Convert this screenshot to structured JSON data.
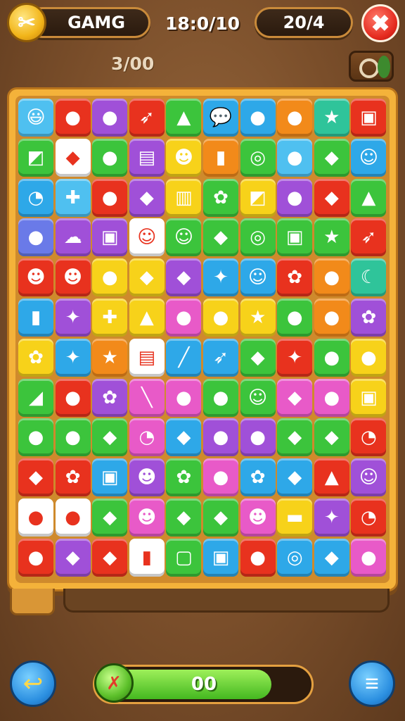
{
  "header": {
    "gem_label": "GAMG",
    "timer": "18:0/10",
    "score": "20/4",
    "moves": "3/00"
  },
  "icons": {
    "coin": "✂",
    "close": "✖",
    "back": "↩",
    "progress": "✗",
    "menu": "≡"
  },
  "progress": {
    "label": "00",
    "fraction": 0.82
  },
  "board": {
    "columns": 10,
    "rows": 12,
    "tiles": [
      [
        "#4fc0f0",
        "😃"
      ],
      [
        "#e8321e",
        "●"
      ],
      [
        "#a050d8",
        "●"
      ],
      [
        "#e8321e",
        "➶"
      ],
      [
        "#3cc43c",
        "▲"
      ],
      [
        "#2ea8e8",
        "💬"
      ],
      [
        "#2ea8e8",
        "●"
      ],
      [
        "#f28a1a",
        "●"
      ],
      [
        "#2fc49a",
        "★"
      ],
      [
        "#e8321e",
        "▣"
      ],
      [
        "#3cc43c",
        "◩"
      ],
      [
        "#ffffff",
        "◆"
      ],
      [
        "#3cc43c",
        "●"
      ],
      [
        "#a050d8",
        "▤"
      ],
      [
        "#f7d21a",
        "☻"
      ],
      [
        "#f28a1a",
        "▮"
      ],
      [
        "#3cc43c",
        "◎"
      ],
      [
        "#4fc0f0",
        "●"
      ],
      [
        "#3cc43c",
        "◆"
      ],
      [
        "#2ea8e8",
        "☺"
      ],
      [
        "#2ea8e8",
        "◔"
      ],
      [
        "#4fc0f0",
        "✚"
      ],
      [
        "#e8321e",
        "●"
      ],
      [
        "#a050d8",
        "◆"
      ],
      [
        "#f7d21a",
        "▥"
      ],
      [
        "#3cc43c",
        "✿"
      ],
      [
        "#f7d21a",
        "◩"
      ],
      [
        "#a050d8",
        "●"
      ],
      [
        "#e8321e",
        "◆"
      ],
      [
        "#3cc43c",
        "▲"
      ],
      [
        "#6a7ae8",
        "●"
      ],
      [
        "#a050d8",
        "☁"
      ],
      [
        "#a050d8",
        "▣"
      ],
      [
        "#ffffff",
        "☺"
      ],
      [
        "#3cc43c",
        "☺"
      ],
      [
        "#3cc43c",
        "◆"
      ],
      [
        "#3cc43c",
        "◎"
      ],
      [
        "#3cc43c",
        "▣"
      ],
      [
        "#3cc43c",
        "★"
      ],
      [
        "#e8321e",
        "➶"
      ],
      [
        "#e8321e",
        "☻"
      ],
      [
        "#e8321e",
        "☻"
      ],
      [
        "#f7d21a",
        "●"
      ],
      [
        "#f7d21a",
        "◆"
      ],
      [
        "#a050d8",
        "◆"
      ],
      [
        "#2ea8e8",
        "✦"
      ],
      [
        "#2ea8e8",
        "☺"
      ],
      [
        "#e8321e",
        "✿"
      ],
      [
        "#f28a1a",
        "●"
      ],
      [
        "#2fc49a",
        "☾"
      ],
      [
        "#2ea8e8",
        "▮"
      ],
      [
        "#a050d8",
        "✦"
      ],
      [
        "#f7d21a",
        "✚"
      ],
      [
        "#f7d21a",
        "▲"
      ],
      [
        "#e85ac8",
        "●"
      ],
      [
        "#f7d21a",
        "●"
      ],
      [
        "#f7d21a",
        "★"
      ],
      [
        "#3cc43c",
        "●"
      ],
      [
        "#f28a1a",
        "●"
      ],
      [
        "#a050d8",
        "✿"
      ],
      [
        "#f7d21a",
        "✿"
      ],
      [
        "#2ea8e8",
        "✦"
      ],
      [
        "#f28a1a",
        "★"
      ],
      [
        "#ffffff",
        "▤"
      ],
      [
        "#2ea8e8",
        "╱"
      ],
      [
        "#2ea8e8",
        "➶"
      ],
      [
        "#3cc43c",
        "◆"
      ],
      [
        "#e8321e",
        "✦"
      ],
      [
        "#3cc43c",
        "●"
      ],
      [
        "#f7d21a",
        "●"
      ],
      [
        "#3cc43c",
        "◢"
      ],
      [
        "#e8321e",
        "●"
      ],
      [
        "#a050d8",
        "✿"
      ],
      [
        "#e85ac8",
        "╲"
      ],
      [
        "#e85ac8",
        "●"
      ],
      [
        "#3cc43c",
        "●"
      ],
      [
        "#3cc43c",
        "☺"
      ],
      [
        "#e85ac8",
        "◆"
      ],
      [
        "#e85ac8",
        "●"
      ],
      [
        "#f7d21a",
        "▣"
      ],
      [
        "#3cc43c",
        "●"
      ],
      [
        "#3cc43c",
        "●"
      ],
      [
        "#3cc43c",
        "◆"
      ],
      [
        "#e85ac8",
        "◔"
      ],
      [
        "#2ea8e8",
        "◆"
      ],
      [
        "#a050d8",
        "●"
      ],
      [
        "#a050d8",
        "●"
      ],
      [
        "#3cc43c",
        "◆"
      ],
      [
        "#3cc43c",
        "◆"
      ],
      [
        "#e8321e",
        "◔"
      ],
      [
        "#e8321e",
        "◆"
      ],
      [
        "#e8321e",
        "✿"
      ],
      [
        "#2ea8e8",
        "▣"
      ],
      [
        "#a050d8",
        "☻"
      ],
      [
        "#3cc43c",
        "✿"
      ],
      [
        "#e85ac8",
        "●"
      ],
      [
        "#2ea8e8",
        "✿"
      ],
      [
        "#2ea8e8",
        "◆"
      ],
      [
        "#e8321e",
        "▲"
      ],
      [
        "#a050d8",
        "☺"
      ],
      [
        "#ffffff",
        "●"
      ],
      [
        "#ffffff",
        "●"
      ],
      [
        "#3cc43c",
        "◆"
      ],
      [
        "#e85ac8",
        "☻"
      ],
      [
        "#3cc43c",
        "◆"
      ],
      [
        "#3cc43c",
        "◆"
      ],
      [
        "#e85ac8",
        "☻"
      ],
      [
        "#f7d21a",
        "▬"
      ],
      [
        "#a050d8",
        "✦"
      ],
      [
        "#e8321e",
        "◔"
      ],
      [
        "#e8321e",
        "●"
      ],
      [
        "#a050d8",
        "◆"
      ],
      [
        "#e8321e",
        "◆"
      ],
      [
        "#ffffff",
        "▮"
      ],
      [
        "#3cc43c",
        "▢"
      ],
      [
        "#2ea8e8",
        "▣"
      ],
      [
        "#e8321e",
        "●"
      ],
      [
        "#2ea8e8",
        "◎"
      ],
      [
        "#2ea8e8",
        "◆"
      ],
      [
        "#e85ac8",
        "●"
      ]
    ]
  }
}
